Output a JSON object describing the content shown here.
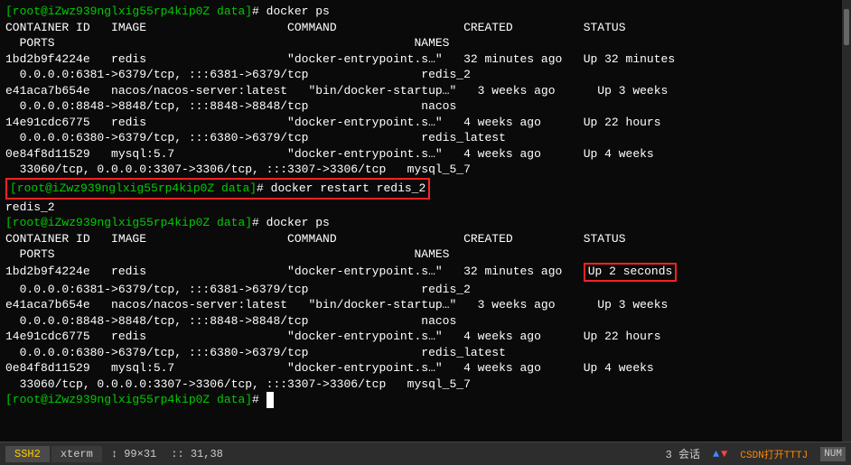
{
  "terminal": {
    "lines": [
      {
        "id": "l1",
        "text": "[root@iZwz939nglxig55rp4kip0Z data]# docker ps",
        "type": "prompt"
      },
      {
        "id": "l2",
        "text": "CONTAINER ID   IMAGE                    COMMAND                  CREATED          STATUS",
        "type": "header"
      },
      {
        "id": "l3",
        "text": "  PORTS                                                   NAMES",
        "type": "header"
      },
      {
        "id": "l4",
        "text": "1bd2b9f4224e   redis                    \"docker-entrypoint.s…\"   32 minutes ago   Up 32 minutes",
        "type": "data"
      },
      {
        "id": "l5",
        "text": "  0.0.0.0:6381->6379/tcp, :::6381->6379/tcp                redis_2",
        "type": "data"
      },
      {
        "id": "l6",
        "text": "e41aca7b654e   nacos/nacos-server:latest   \"bin/docker-startup…\"   3 weeks ago      Up 3 weeks",
        "type": "data"
      },
      {
        "id": "l7",
        "text": "  0.0.0.0:8848->8848/tcp, :::8848->8848/tcp                nacos",
        "type": "data"
      },
      {
        "id": "l8",
        "text": "14e91cdc6775   redis                    \"docker-entrypoint.s…\"   4 weeks ago      Up 22 hours",
        "type": "data"
      },
      {
        "id": "l9",
        "text": "  0.0.0.0:6380->6379/tcp, :::6380->6379/tcp                redis_latest",
        "type": "data"
      },
      {
        "id": "l10",
        "text": "0e84f8d11529   mysql:5.7                \"docker-entrypoint.s…\"   4 weeks ago      Up 4 weeks",
        "type": "data"
      },
      {
        "id": "l11",
        "text": "  33060/tcp, 0.0.0.0:3307->3306/tcp, :::3307->3306/tcp   mysql_5_7",
        "type": "data"
      },
      {
        "id": "l12",
        "text": "[root@iZwz939nglxig55rp4kip0Z data]# docker restart redis_2",
        "type": "prompt-highlighted"
      },
      {
        "id": "l13",
        "text": "redis_2",
        "type": "data"
      },
      {
        "id": "l14",
        "text": "[root@iZwz939nglxig55rp4kip0Z data]# docker ps",
        "type": "prompt"
      },
      {
        "id": "l15",
        "text": "CONTAINER ID   IMAGE                    COMMAND                  CREATED          STATUS",
        "type": "header"
      },
      {
        "id": "l16",
        "text": "  PORTS                                                   NAMES",
        "type": "header"
      },
      {
        "id": "l17",
        "text": "1bd2b9f4224e   redis                    \"docker-entrypoint.s…\"   32 minutes ago  ",
        "type": "data"
      },
      {
        "id": "l17b",
        "text": "Up 2 seconds",
        "type": "data-highlighted"
      },
      {
        "id": "l18",
        "text": "  0.0.0.0:6381->6379/tcp, :::6381->6379/tcp                redis_2",
        "type": "data"
      },
      {
        "id": "l19",
        "text": "e41aca7b654e   nacos/nacos-server:latest   \"bin/docker-startup…\"   3 weeks ago      Up 3 weeks",
        "type": "data"
      },
      {
        "id": "l20",
        "text": "  0.0.0.0:8848->8848/tcp, :::8848->8848/tcp                nacos",
        "type": "data"
      },
      {
        "id": "l21",
        "text": "14e91cdc6775   redis                    \"docker-entrypoint.s…\"   4 weeks ago      Up 22 hours",
        "type": "data"
      },
      {
        "id": "l22",
        "text": "  0.0.0.0:6380->6379/tcp, :::6380->6379/tcp                redis_latest",
        "type": "data"
      },
      {
        "id": "l23",
        "text": "0e84f8d11529   mysql:5.7                \"docker-entrypoint.s…\"   4 weeks ago      Up 4 weeks",
        "type": "data"
      },
      {
        "id": "l24",
        "text": "  33060/tcp, 0.0.0.0:3307->3306/tcp, :::3307->3306/tcp   mysql_5_7",
        "type": "data"
      },
      {
        "id": "l25",
        "text": "[root@iZwz939nglxig55rp4kip0Z data]# ",
        "type": "prompt-cursor"
      }
    ]
  },
  "statusbar": {
    "ssh2": "SSH2",
    "xterm": "xterm",
    "size": "↕ 99×31",
    "pos": ":: 31,38",
    "sessions": "3 会话",
    "up_arrow": "▲",
    "down_arrow": "▼",
    "csdn": "CSDN打开TTTJ",
    "num": "NUM"
  }
}
